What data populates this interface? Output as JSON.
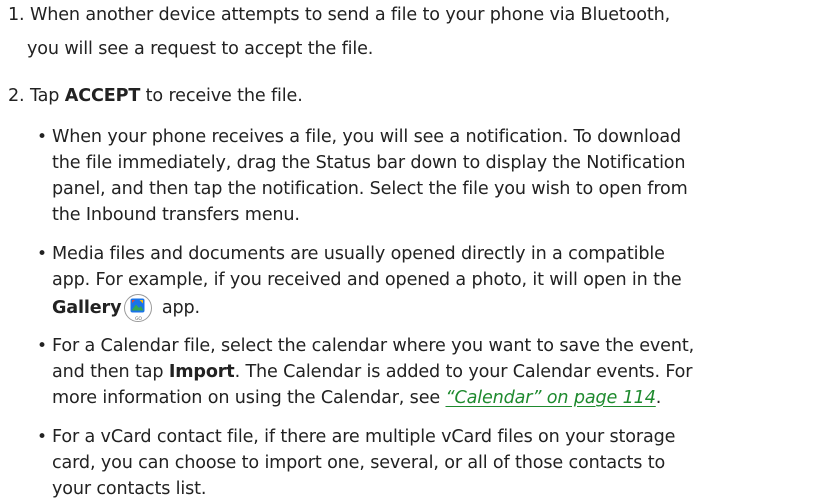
{
  "step1": {
    "number": "1.",
    "lines": [
      "When another device attempts to send a file to your phone via Bluetooth,",
      "you will see a request to accept the file."
    ]
  },
  "step2": {
    "number": "2.",
    "pre": "Tap ",
    "bold": "ACCEPT",
    "post": " to receive the file."
  },
  "bullets": {
    "b1": [
      "When your phone receives a file, you will see a notification. To download",
      "the file immediately, drag the Status bar down to display the Notification",
      "panel, and then tap the notification. Select the file you wish to open from",
      "the Inbound transfers menu."
    ],
    "b2": {
      "lines": [
        "Media files and documents are usually opened directly in a compatible",
        "app. For example, if you received and opened a photo, it will open in the"
      ],
      "app_name": "Gallery",
      "icon": "gallery-go-app-icon",
      "icon_label": "GO",
      "tail": " app."
    },
    "b3": {
      "line1": "For a Calendar file, select the calendar where you want to save the event,",
      "line2_pre": "and then tap ",
      "line2_bold": "Import",
      "line2_post": ". The Calendar is added to your Calendar events. For",
      "line3_pre": "more information on using the Calendar, see ",
      "link": "“Calendar” on page 114",
      "line3_post": "."
    },
    "b4": [
      "For a vCard contact file, if there are multiple vCard files on your storage",
      "card, you can choose to import one, several, or all of those contacts to",
      "your contacts list."
    ],
    "bullet_char": "•"
  },
  "colors": {
    "text": "#222222",
    "link": "#1e8a2e"
  }
}
